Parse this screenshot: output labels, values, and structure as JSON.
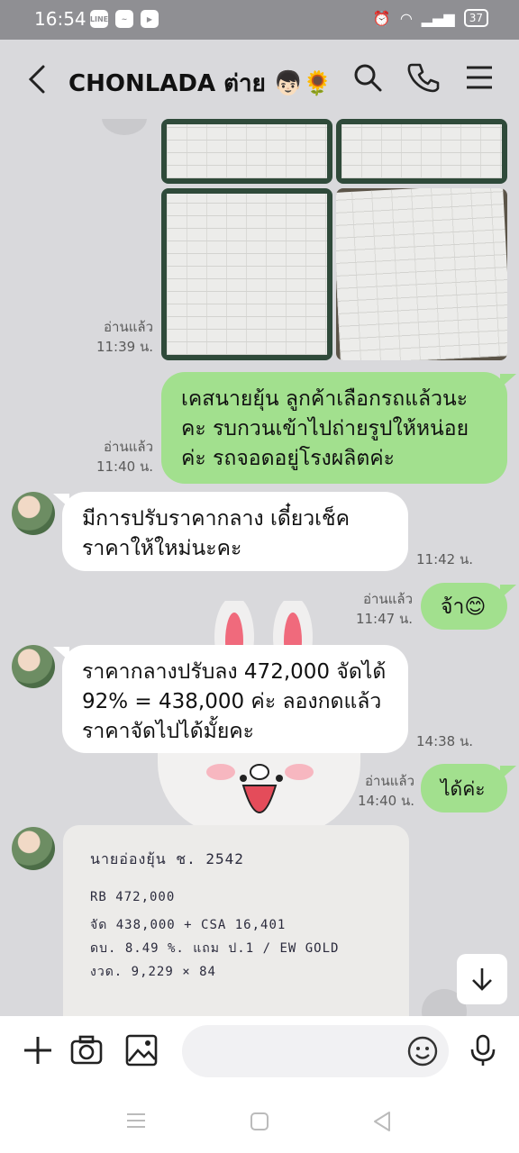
{
  "status": {
    "time": "16:54",
    "battery": "37"
  },
  "header": {
    "title": "CHONLADA ต่าย 👦🏻🌻"
  },
  "messages": {
    "read1": "อ่านแล้ว",
    "time1": "11:39 น.",
    "out1": "เคสนายยุ้น ลูกค้าเลือกรถแล้วนะ\nคะ รบกวนเข้าไปถ่ายรูปให้หน่อย\nค่ะ รถจอดอยู่โรงผลิตค่ะ",
    "read2": "อ่านแล้ว",
    "time2": "11:40 น.",
    "in1": "มีการปรับราคากลาง เดี๋ยวเช็ค\nราคาให้ใหม่นะคะ",
    "in1_time": "11:42 น.",
    "read3": "อ่านแล้ว",
    "time3": "11:47 น.",
    "out2": "จ้า😊",
    "in2": "ราคากลางปรับลง 472,000 จัดได้\n92% =  438,000 ค่ะ ลองกดแล้ว\nราคาจัดไปได้มั้ยคะ",
    "in2_time": "14:38 น.",
    "read4": "อ่านแล้ว",
    "time4": "14:40 น.",
    "out3": "ได้ค่ะ"
  },
  "note": {
    "line1": "นายอ่องยุ้น   ช. 2542",
    "line2": "RB   472,000",
    "line3": "จัด   438,000  +  CSA  16,401",
    "line4": "ดบ.   8.49 %.   แถม ป.1 / EW GOLD",
    "line5": "งวด.  9,229  × 84"
  },
  "composer": {
    "placeholder": ""
  }
}
